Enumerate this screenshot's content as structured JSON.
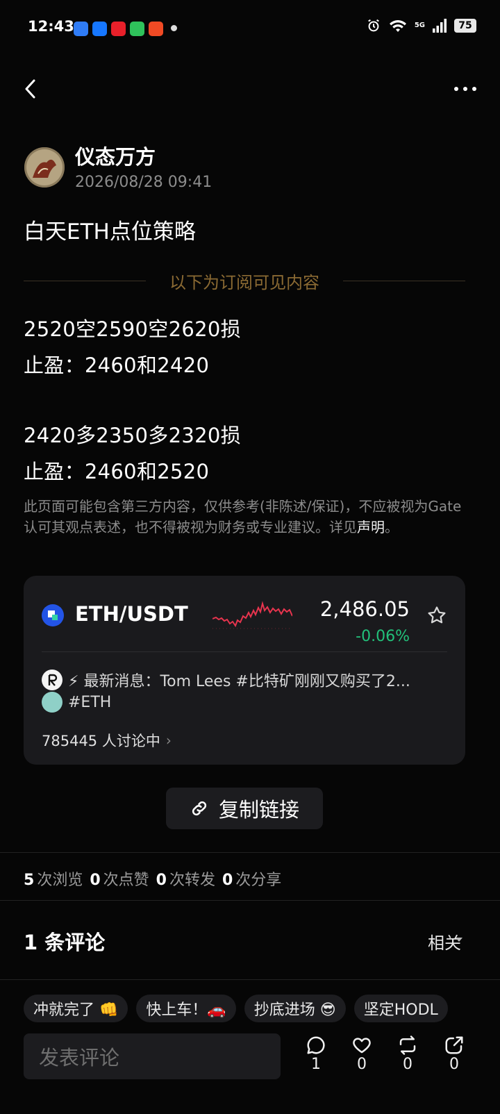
{
  "status_bar": {
    "time": "12:43",
    "network": "5G",
    "battery": "75"
  },
  "author": {
    "name": "仪态万方",
    "time": "2026/08/28 09:41"
  },
  "post": {
    "title": "白天ETH点位策略",
    "subscriber_divider": "以下为订阅可见内容",
    "lines": [
      "2520空2590空2620损",
      "止盈：2460和2420",
      "2420多2350多2320损",
      "止盈：2460和2520"
    ],
    "disclaimer": "此页面可能包含第三方内容，仅供参考(非陈述/保证)，不应被视为Gate认可其观点表述，也不得被视为财务或专业建议。详见",
    "disclaimer_link": "声明",
    "disclaimer_end": "。"
  },
  "ticker_card": {
    "pair": "ETH/USDT",
    "price": "2,486.05",
    "change": "-0.06%",
    "news": "⚡ 最新消息：Tom Lees #比特矿刚刚又购买了2...",
    "tag": "#ETH",
    "discussing": "785445 人讨论中",
    "colors": {
      "up": "#22c17a",
      "sparkline": "#e8344e"
    }
  },
  "copy_link": {
    "label": "复制链接"
  },
  "stats": [
    {
      "count": "5",
      "label": "次浏览"
    },
    {
      "count": "0",
      "label": "次点赞"
    },
    {
      "count": "0",
      "label": "次转发"
    },
    {
      "count": "0",
      "label": "次分享"
    }
  ],
  "comments": {
    "title": "1 条评论",
    "sort": "相关"
  },
  "quick_replies": [
    "冲就完了 👊",
    "快上车！🚗",
    "抄底进场 😎",
    "坚定HODL"
  ],
  "bottom_bar": {
    "placeholder": "发表评论",
    "actions": [
      {
        "icon": "comment-icon",
        "count": "1"
      },
      {
        "icon": "heart-icon",
        "count": "0"
      },
      {
        "icon": "repost-icon",
        "count": "0"
      },
      {
        "icon": "share-icon",
        "count": "0"
      }
    ]
  }
}
